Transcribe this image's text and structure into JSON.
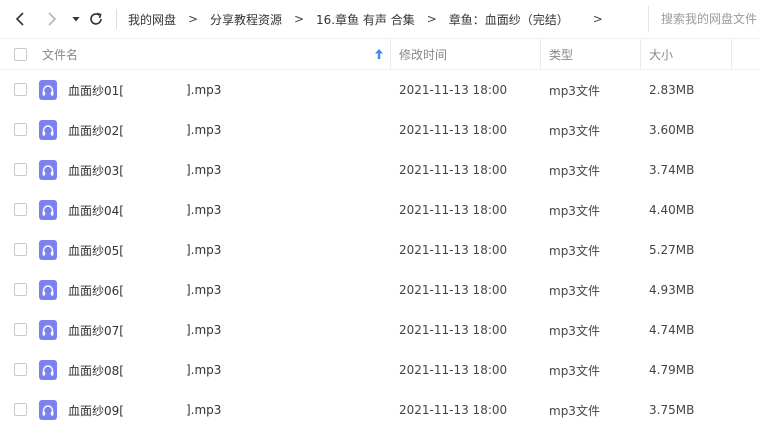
{
  "toolbar": {
    "back_icon": "chevron-left-icon",
    "forward_icon": "chevron-right-icon",
    "dropdown_icon": "caret-down-icon",
    "refresh_icon": "refresh-icon"
  },
  "breadcrumb": {
    "items": [
      "我的网盘",
      "分享教程资源",
      "16.章鱼 有声 合集",
      "章鱼：血面纱（完结）"
    ],
    "separator": ">"
  },
  "search": {
    "placeholder": "搜索我的网盘文件"
  },
  "columns": {
    "name": "文件名",
    "modified": "修改时间",
    "type": "类型",
    "size": "大小",
    "sort_icon": "sort-up-arrow-icon"
  },
  "colors": {
    "accent": "#3b8cf2",
    "audio_icon": "#7b82f0"
  },
  "files": [
    {
      "name_prefix": "血面纱01[",
      "name_suffix": "].mp3",
      "modified": "2021-11-13 18:00",
      "type": "mp3文件",
      "size": "2.83MB",
      "icon": "audio-file-icon"
    },
    {
      "name_prefix": "血面纱02[",
      "name_suffix": "].mp3",
      "modified": "2021-11-13 18:00",
      "type": "mp3文件",
      "size": "3.60MB",
      "icon": "audio-file-icon"
    },
    {
      "name_prefix": "血面纱03[",
      "name_suffix": "].mp3",
      "modified": "2021-11-13 18:00",
      "type": "mp3文件",
      "size": "3.74MB",
      "icon": "audio-file-icon"
    },
    {
      "name_prefix": "血面纱04[",
      "name_suffix": "].mp3",
      "modified": "2021-11-13 18:00",
      "type": "mp3文件",
      "size": "4.40MB",
      "icon": "audio-file-icon"
    },
    {
      "name_prefix": "血面纱05[",
      "name_suffix": "].mp3",
      "modified": "2021-11-13 18:00",
      "type": "mp3文件",
      "size": "5.27MB",
      "icon": "audio-file-icon"
    },
    {
      "name_prefix": "血面纱06[",
      "name_suffix": "].mp3",
      "modified": "2021-11-13 18:00",
      "type": "mp3文件",
      "size": "4.93MB",
      "icon": "audio-file-icon"
    },
    {
      "name_prefix": "血面纱07[",
      "name_suffix": "].mp3",
      "modified": "2021-11-13 18:00",
      "type": "mp3文件",
      "size": "4.74MB",
      "icon": "audio-file-icon"
    },
    {
      "name_prefix": "血面纱08[",
      "name_suffix": "].mp3",
      "modified": "2021-11-13 18:00",
      "type": "mp3文件",
      "size": "4.79MB",
      "icon": "audio-file-icon"
    },
    {
      "name_prefix": "血面纱09[",
      "name_suffix": "].mp3",
      "modified": "2021-11-13 18:00",
      "type": "mp3文件",
      "size": "3.75MB",
      "icon": "audio-file-icon"
    }
  ]
}
